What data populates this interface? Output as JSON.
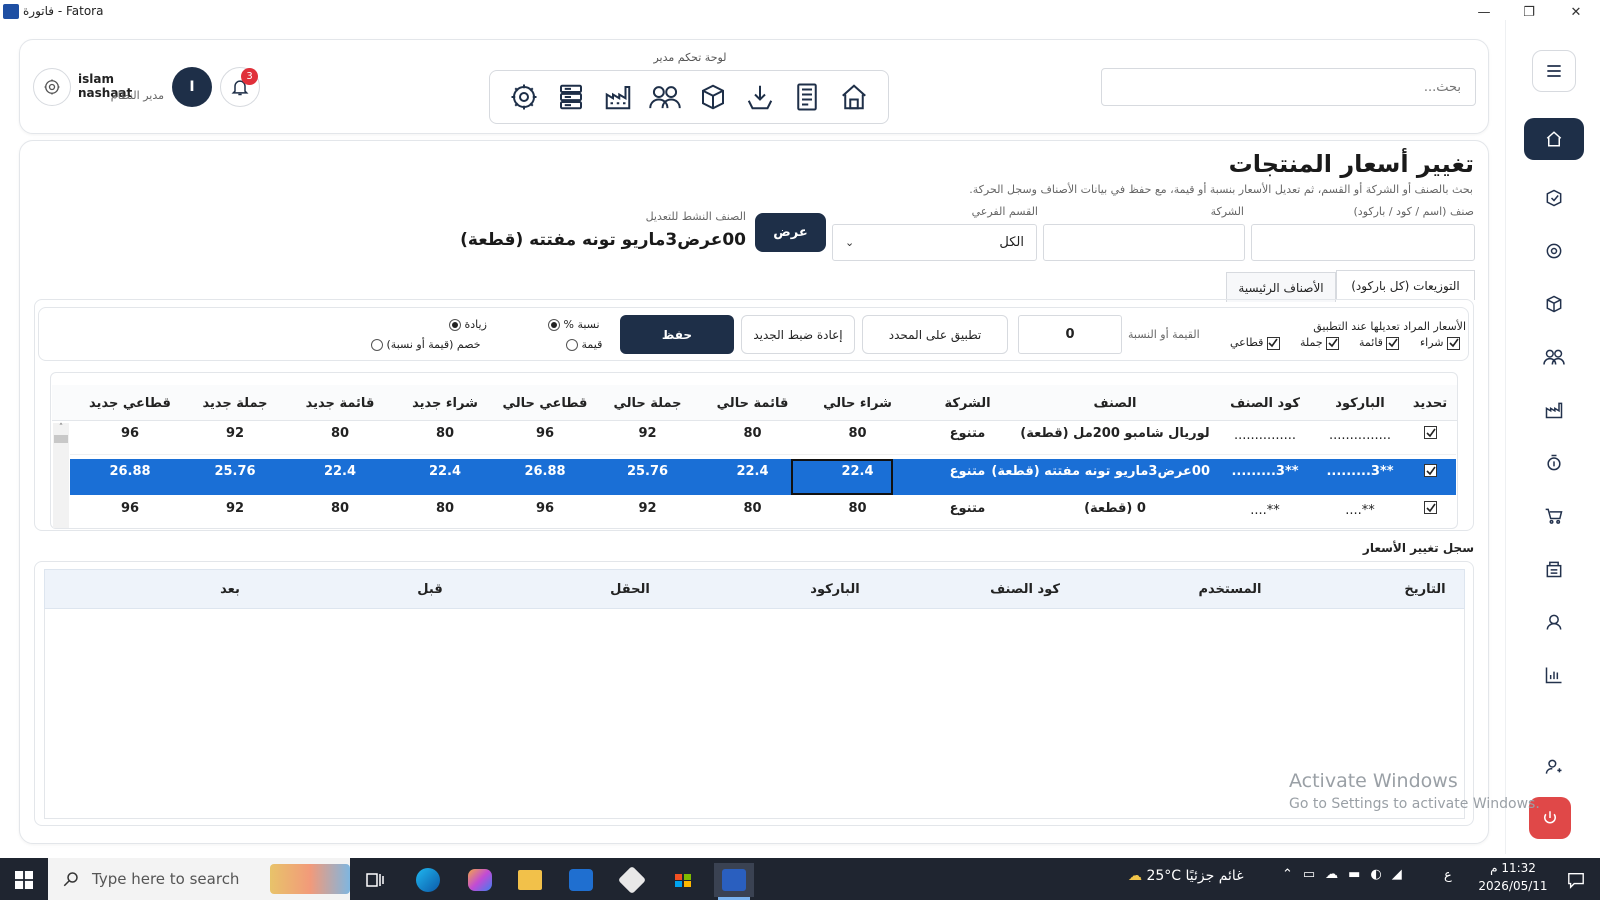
{
  "window": {
    "title": "فاتورة - Fatora",
    "minimize": "—",
    "maximize": "❐",
    "close": "✕"
  },
  "header": {
    "search_placeholder": "بحث...",
    "toolbar_label": "لوحة تحكم مدير",
    "toolbar_icons": [
      "settings-icon",
      "database-icon",
      "factory-icon",
      "users-icon",
      "box-icon",
      "import-icon",
      "receipt-icon",
      "home-icon"
    ],
    "user": {
      "name": "islam nashaat",
      "role": "مدير النظام",
      "initial": "I"
    },
    "notifications": "3"
  },
  "page": {
    "title": "تغيير أسعار المنتجات",
    "subtitle": "بحث بالصنف أو الشركة أو القسم، ثم تعديل الأسعار بنسبة أو قيمة، مع حفظ في بيانات الأصناف وسجل الحركة.",
    "filters": {
      "item_label": "صنف (اسم / كود / باركود)",
      "company_label": "الشركة",
      "subdept_label": "القسم الفرعي",
      "subdept_value": "الكل",
      "show_button": "عرض",
      "active_label": "الصنف النشط للتعديل",
      "active_value": "00عرض3ماريو تونه مفتته (قطعة)"
    },
    "tabs": [
      "التوزيعات (كل باركود)",
      "الأصناف الرئيسية"
    ],
    "controls": {
      "prices_label": "الأسعار المراد تعديلها عند التطبيق",
      "price_types": [
        "شراء",
        "قائمة",
        "جملة",
        "قطاعي"
      ],
      "value_label": "القيمة أو النسبة",
      "value": "0",
      "apply_button": "تطبيق على المحدد",
      "reset_button": "إعادة ضبط الجديد",
      "save_button": "حفظ",
      "mode_percent": "نسبة %",
      "mode_value": "قيمة",
      "dir_increase": "زيادة",
      "dir_decrease": "خصم (قيمة أو نسبة)"
    },
    "table": {
      "columns": [
        "تحديد",
        "الباركود",
        "كود الصنف",
        "الصنف",
        "الشركة",
        "شراء حالي",
        "قائمة حالي",
        "جملة حالي",
        "قطاعي حالي",
        "شراء جديد",
        "قائمة جديد",
        "جملة جديد",
        "قطاعي جديد"
      ],
      "rows": [
        {
          "barcode": "...............",
          "code": "...............",
          "name": "لوريال شامبو 200مل (قطعة)",
          "company": "متنوع",
          "buy": "80",
          "list": "80",
          "wholesale": "92",
          "retail": "96",
          "new_buy": "80",
          "new_list": "80",
          "new_wholesale": "92",
          "new_retail": "96",
          "selected": false
        },
        {
          "barcode": "**3.........",
          "code": "**3.........",
          "name": "00عرض3ماريو تونه مفتته (قطعة)",
          "company": "متنوع",
          "buy": "22.4",
          "list": "22.4",
          "wholesale": "25.76",
          "retail": "26.88",
          "new_buy": "22.4",
          "new_list": "22.4",
          "new_wholesale": "25.76",
          "new_retail": "26.88",
          "selected": true
        },
        {
          "barcode": "**....",
          "code": "**....",
          "name": "0 (قطعة)",
          "company": "متنوع",
          "buy": "80",
          "list": "80",
          "wholesale": "92",
          "retail": "96",
          "new_buy": "80",
          "new_list": "80",
          "new_wholesale": "92",
          "new_retail": "96",
          "selected": false
        }
      ]
    },
    "log": {
      "title": "سجل تغيير الأسعار",
      "columns": [
        "التاريخ",
        "المستخدم",
        "كود الصنف",
        "الباركود",
        "الحقل",
        "قبل",
        "بعد"
      ]
    }
  },
  "watermark": {
    "line1": "Activate Windows",
    "line2": "Go to Settings to activate Windows."
  },
  "taskbar": {
    "search_placeholder": "Type here to search",
    "weather": "25°C  غائم جزئيًا",
    "time": "11:32 م",
    "date": "2026/05/11",
    "lang": "ع"
  },
  "colors": {
    "primary": "#1e2f48",
    "selection": "#1a6fd6",
    "danger": "#e04848"
  }
}
